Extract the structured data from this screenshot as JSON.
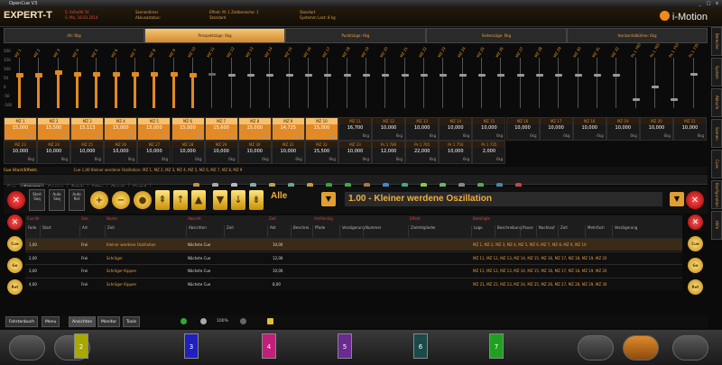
{
  "window": {
    "title": "OpenCue V3",
    "controls": "_ □ x"
  },
  "header": {
    "brand": "EXPERT-T",
    "info1": [
      "S: 4d5e96 54",
      "S: Mo, 18.03.2014"
    ],
    "info2": [
      "Szenentimer",
      "Akkusastatus:"
    ],
    "info3": [
      "Effekt: M: 1 Zeitbereiche: 1",
      "Standard"
    ],
    "info4": [
      "Standart",
      "Systemm Last: 8 kg"
    ],
    "logo": "i-Motion"
  },
  "right_tabs": [
    "Bereiche",
    "System",
    "Ablaufe",
    "Szenen",
    "Cues",
    "Konfiguration",
    "Hilfe"
  ],
  "fader_groups": [
    {
      "label": "Ait: 6kg",
      "active": false
    },
    {
      "label": "Prospektzüge: 6kg",
      "active": true
    },
    {
      "label": "Punktzüge: 6kg",
      "active": false
    },
    {
      "label": "Seitenzüge: 6kg",
      "active": false
    },
    {
      "label": "Horizontalbühne: 6kg",
      "active": false
    }
  ],
  "scale": [
    "200",
    "150",
    "100",
    "50",
    "0",
    "-50",
    "-100"
  ],
  "faders": [
    {
      "label": "MZ 1",
      "pos": 0.3,
      "kind": "orange"
    },
    {
      "label": "MZ 2",
      "pos": 0.3,
      "kind": "orange"
    },
    {
      "label": "MZ 3",
      "pos": 0.25,
      "kind": "orange"
    },
    {
      "label": "MZ 4",
      "pos": 0.28,
      "kind": "orange"
    },
    {
      "label": "MZ 5",
      "pos": 0.28,
      "kind": "orange"
    },
    {
      "label": "MZ 6",
      "pos": 0.28,
      "kind": "orange"
    },
    {
      "label": "MZ 7",
      "pos": 0.28,
      "kind": "orange"
    },
    {
      "label": "MZ 8",
      "pos": 0.28,
      "kind": "orange"
    },
    {
      "label": "MZ 9",
      "pos": 0.28,
      "kind": "orange"
    },
    {
      "label": "MZ 10",
      "pos": 0.3,
      "kind": "orange"
    },
    {
      "label": "MZ 11",
      "pos": 0.3,
      "kind": "dim"
    },
    {
      "label": "MZ 12",
      "pos": 0.32,
      "kind": "grey"
    },
    {
      "label": "MZ 13",
      "pos": 0.32,
      "kind": "grey"
    },
    {
      "label": "MZ 14",
      "pos": 0.32,
      "kind": "grey"
    },
    {
      "label": "MZ 15",
      "pos": 0.32,
      "kind": "grey"
    },
    {
      "label": "MZ 16",
      "pos": 0.32,
      "kind": "grey"
    },
    {
      "label": "MZ 17",
      "pos": 0.32,
      "kind": "grey"
    },
    {
      "label": "MZ 18",
      "pos": 0.32,
      "kind": "grey"
    },
    {
      "label": "MZ 19",
      "pos": 0.32,
      "kind": "grey"
    },
    {
      "label": "MZ 20",
      "pos": 0.32,
      "kind": "grey"
    },
    {
      "label": "MZ 21",
      "pos": 0.32,
      "kind": "grey"
    },
    {
      "label": "MZ 22",
      "pos": 0.32,
      "kind": "grey"
    },
    {
      "label": "MZ 23",
      "pos": 0.32,
      "kind": "grey"
    },
    {
      "label": "MZ 24",
      "pos": 0.32,
      "kind": "grey"
    },
    {
      "label": "MZ 25",
      "pos": 0.32,
      "kind": "grey"
    },
    {
      "label": "MZ 26",
      "pos": 0.32,
      "kind": "grey"
    },
    {
      "label": "MZ 27",
      "pos": 0.32,
      "kind": "grey"
    },
    {
      "label": "MZ 28",
      "pos": 0.32,
      "kind": "grey"
    },
    {
      "label": "MZ 29",
      "pos": 0.32,
      "kind": "grey"
    },
    {
      "label": "MZ 30",
      "pos": 0.32,
      "kind": "grey"
    },
    {
      "label": "MZ 31",
      "pos": 0.32,
      "kind": "grey"
    },
    {
      "label": "MZ 32",
      "pos": 0.32,
      "kind": "grey"
    },
    {
      "label": "Ps 1 780",
      "pos": 0.8,
      "kind": "grey"
    },
    {
      "label": "Ps 1 765",
      "pos": 0.55,
      "kind": "grey"
    },
    {
      "label": "Ps 1 750",
      "pos": 0.8,
      "kind": "grey"
    },
    {
      "label": "Ps 1 735",
      "pos": 0.3,
      "kind": "grey"
    }
  ],
  "grid_row1": [
    {
      "name": "MZ 1",
      "value": "15,000",
      "unit": "6kg",
      "hot": true
    },
    {
      "name": "MZ 2",
      "value": "15,500",
      "unit": "6kg",
      "hot": true
    },
    {
      "name": "MZ 3",
      "value": "15,113",
      "unit": "6kg",
      "hot": true
    },
    {
      "name": "MZ 4",
      "value": "15,000",
      "unit": "6kg",
      "hot": true
    },
    {
      "name": "MZ 5",
      "value": "15,000",
      "unit": "6kg",
      "hot": true
    },
    {
      "name": "MZ 6",
      "value": "15,000",
      "unit": "6kg",
      "hot": true
    },
    {
      "name": "MZ 7",
      "value": "15,600",
      "unit": "6kg",
      "hot": true
    },
    {
      "name": "MZ 8",
      "value": "15,000",
      "unit": "6kg",
      "hot": true
    },
    {
      "name": "MZ 9",
      "value": "14,725",
      "unit": "6kg",
      "hot": true
    },
    {
      "name": "MZ 10",
      "value": "15,000",
      "unit": "6kg",
      "hot": true
    },
    {
      "name": "MZ 11",
      "value": "16,700",
      "unit": "6kg",
      "hot": false
    },
    {
      "name": "MZ 12",
      "value": "10,000",
      "unit": "6kg",
      "hot": false
    },
    {
      "name": "MZ 13",
      "value": "10,000",
      "unit": "6kg",
      "hot": false
    },
    {
      "name": "MZ 14",
      "value": "10,000",
      "unit": "6kg",
      "hot": false
    },
    {
      "name": "MZ 15",
      "value": "10,000",
      "unit": "6kg",
      "hot": false
    },
    {
      "name": "MZ 16",
      "value": "10,000",
      "unit": "6kg",
      "hot": false
    },
    {
      "name": "MZ 17",
      "value": "10,000",
      "unit": "6kg",
      "hot": false
    },
    {
      "name": "MZ 18",
      "value": "10,000",
      "unit": "6kg",
      "hot": false
    },
    {
      "name": "MZ 19",
      "value": "10,000",
      "unit": "6kg",
      "hot": false
    },
    {
      "name": "MZ 20",
      "value": "10,000",
      "unit": "6kg",
      "hot": false
    },
    {
      "name": "MZ 21",
      "value": "10,000",
      "unit": "6kg",
      "hot": false
    }
  ],
  "grid_row2": [
    {
      "name": "MZ 23",
      "value": "10,000",
      "unit": "6kg"
    },
    {
      "name": "MZ 24",
      "value": "10,000",
      "unit": "6kg"
    },
    {
      "name": "MZ 25",
      "value": "10,000",
      "unit": "6kg"
    },
    {
      "name": "MZ 26",
      "value": "10,000",
      "unit": "6kg"
    },
    {
      "name": "MZ 27",
      "value": "10,000",
      "unit": "6kg"
    },
    {
      "name": "MZ 28",
      "value": "10,000",
      "unit": "6kg"
    },
    {
      "name": "MZ 29",
      "value": "10,000",
      "unit": "6kg"
    },
    {
      "name": "MZ 30",
      "value": "10,000",
      "unit": "6kg"
    },
    {
      "name": "MZ 31",
      "value": "10,000",
      "unit": "6kg"
    },
    {
      "name": "MZ 32",
      "value": "15,500",
      "unit": "6kg"
    },
    {
      "name": "MZ 33",
      "value": "10,000",
      "unit": "6kg"
    },
    {
      "name": "Ps 1 780",
      "value": "12,000",
      "unit": "6kg"
    },
    {
      "name": "Ps 1 765",
      "value": "22,000",
      "unit": "6kg"
    },
    {
      "name": "Ps 1 750",
      "value": "10,000",
      "unit": "6kg"
    },
    {
      "name": "Ps 1 735",
      "value": "2,000",
      "unit": "6kg"
    }
  ],
  "info_line": {
    "label": "Cue Start/Effekt:",
    "text": "Cue 1,00 Kleiner werdene Oszillation: MZ 1, MZ 2, MZ 3, MZ 4, MZ 5, MZ 6, MZ 7, MZ 8, MZ 9"
  },
  "tabs": [
    "Cues",
    "Sequenz",
    "Gruppen",
    "Details",
    "Editor",
    "Chronik",
    "Einstell"
  ],
  "cue_selector": {
    "label": "Alle",
    "title": "1.00 - Kleiner werdene Oszillation"
  },
  "toggles": [
    {
      "label": "Start Seq",
      "state": "on"
    },
    {
      "label": "Auto Seq",
      "state": "off"
    },
    {
      "label": "Auto Ret",
      "state": "on"
    }
  ],
  "table": {
    "headers": [
      "Cue Nr",
      "Ges.",
      "Name",
      "Absicht",
      "Zeit",
      "Art/Verzög.",
      "Effekt",
      "Beteiligte"
    ],
    "subheaders": [
      "Fade",
      "Start",
      "Art",
      "Zeit",
      "Absichten",
      "Zeit",
      "Akt",
      "Beschrei.",
      "Pfade",
      "Verzögerung",
      "Nummer",
      "Zielmitglieder",
      "Logo",
      "Beschreibung",
      "Pause",
      "Nachlauf",
      "Zeit",
      "Mehrfach",
      "Verzögerung"
    ],
    "rows": [
      {
        "nr": "1,00",
        "ges": "Frei",
        "name": "Kleiner werdene Oszillation",
        "absicht": "Nächste Cue",
        "zeit": "10,00",
        "beteiligte": "MZ 1, MZ 2, MZ 3, MZ 4, MZ 5, MZ 6, MZ 7, MZ 8, MZ 9, MZ 10"
      },
      {
        "nr": "2,00",
        "ges": "Frei",
        "name": "Schräger",
        "absicht": "Nächste Cue",
        "zeit": "12,00",
        "beteiligte": "MZ 11, MZ 12, MZ 13, MZ 14, MZ 15, MZ 16, MZ 17, MZ 18, MZ 19, MZ 20"
      },
      {
        "nr": "3,00",
        "ges": "Frei",
        "name": "Schräger Kippen",
        "absicht": "Nächste Cue",
        "zeit": "10,00",
        "beteiligte": "MZ 11, MZ 12, MZ 13, MZ 14, MZ 15, MZ 16, MZ 17, MZ 18, MZ 19, MZ 20"
      },
      {
        "nr": "4,00",
        "ges": "Frei",
        "name": "Schräger Kippen",
        "absicht": "Nächste Cue",
        "zeit": "8,00",
        "beteiligte": "MZ 21, MZ 22, MZ 23, MZ 24, MZ 25, MZ 26, MZ 27, MZ 28, MZ 29, MZ 30"
      }
    ]
  },
  "nav": [
    "Fahrtenbuch",
    "Menu",
    "Ansichten",
    "Monitor",
    "Tools"
  ],
  "nav_icons": {
    "zoom": "100%"
  },
  "bottom_pads": [
    {
      "num": "2",
      "color": "#a8a800"
    },
    {
      "num": "3",
      "color": "#2020c0"
    },
    {
      "num": "4",
      "color": "#c0207a"
    },
    {
      "num": "5",
      "color": "#6a2a90"
    },
    {
      "num": "6",
      "color": "#1a4a4a"
    },
    {
      "num": "7",
      "color": "#20a020"
    }
  ],
  "colors": {
    "accent": "#e28a27",
    "brand": "#f08a1a",
    "alert": "#e24a3a"
  }
}
